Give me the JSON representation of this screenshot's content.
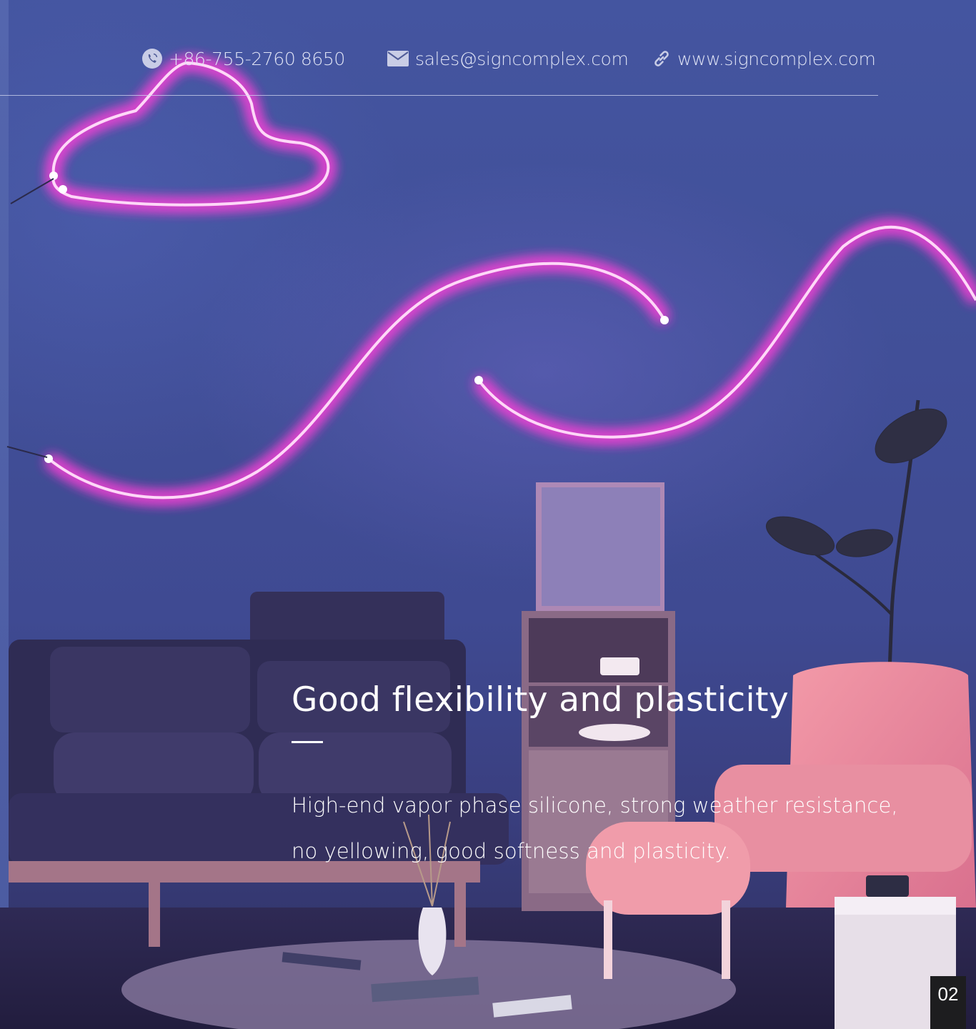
{
  "header": {
    "phone": "+86-755-2760 8650",
    "email": "sales@signcomplex.com",
    "website": "www.signcomplex.com",
    "icons": [
      "phone-icon",
      "mail-icon",
      "link-icon"
    ]
  },
  "content": {
    "headline": "Good flexibility and plasticity",
    "body": "High-end vapor phase silicone, strong weather resistance, no yellowing, good softness and plasticity."
  },
  "footer": {
    "page_number": "02"
  },
  "colors": {
    "neon": "#ff4fe0",
    "wall": "#4455a0",
    "text": "#ffffff",
    "page_badge": "#1d1d1f"
  }
}
